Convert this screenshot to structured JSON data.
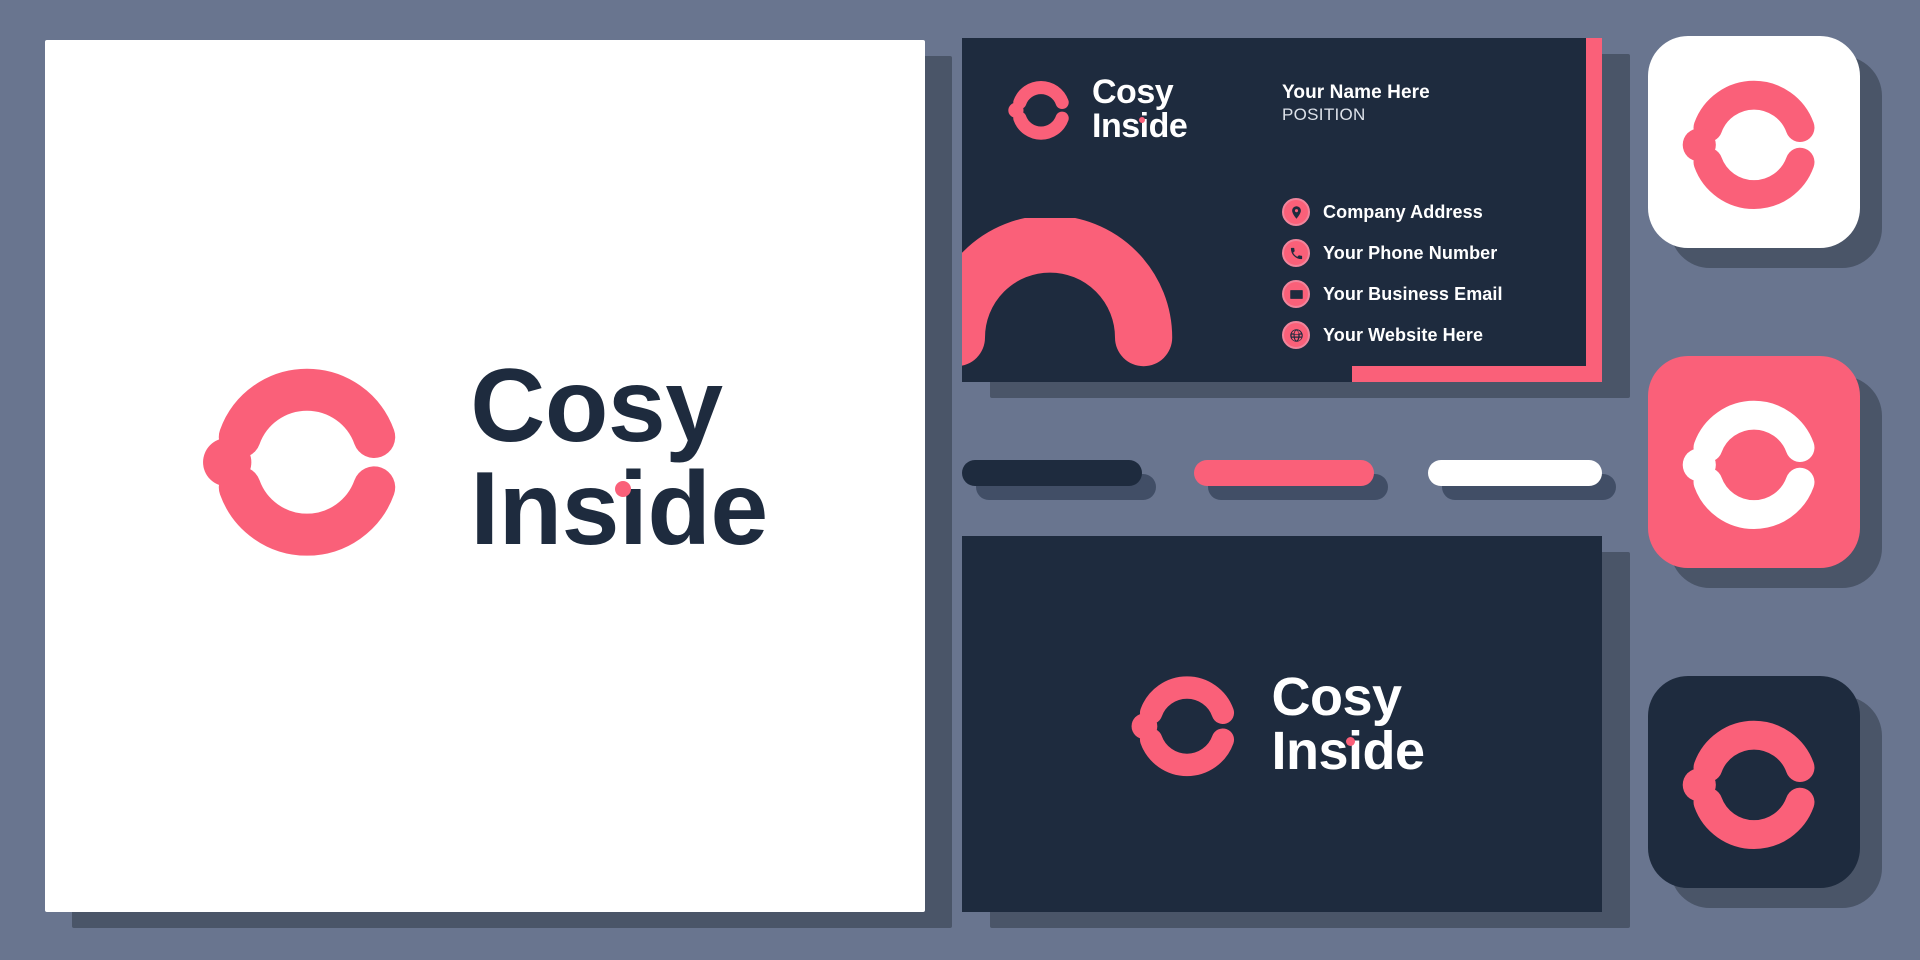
{
  "palette": {
    "background": "#69758F",
    "pink": "#FA6079",
    "navy": "#1E2B3E",
    "white": "#FFFFFF",
    "shadow": "#4A5568",
    "shadow_deep": "#414E66"
  },
  "brand": {
    "name_line1": "Cosy",
    "name_line2": "Inside",
    "mark_name": "letter-c-mark"
  },
  "logo_board": {
    "name_line1": "Cosy",
    "name_line2": "Inside"
  },
  "business_card": {
    "brand_line1": "Cosy",
    "brand_line2": "Inside",
    "person_name": "Your Name Here",
    "person_position": "POSITION",
    "contacts": [
      {
        "icon": "location-pin-icon",
        "label": "Company Address"
      },
      {
        "icon": "phone-icon",
        "label": "Your Phone Number"
      },
      {
        "icon": "envelope-icon",
        "label": "Your Business Email"
      },
      {
        "icon": "globe-icon",
        "label": "Your Website Here"
      }
    ]
  },
  "color_swatches": [
    {
      "name": "navy-swatch",
      "color": "#1E2B3E"
    },
    {
      "name": "pink-swatch",
      "color": "#FA6079"
    },
    {
      "name": "white-swatch",
      "color": "#FFFFFF"
    }
  ],
  "dark_board": {
    "name_line1": "Cosy",
    "name_line2": "Inside"
  },
  "app_icons": [
    {
      "name": "app-icon-light",
      "tile_color": "#FFFFFF",
      "mark_color": "#FA6079"
    },
    {
      "name": "app-icon-pink",
      "tile_color": "#FA6079",
      "mark_color": "#FFFFFF"
    },
    {
      "name": "app-icon-dark",
      "tile_color": "#1E2B3E",
      "mark_color": "#FA6079"
    }
  ]
}
